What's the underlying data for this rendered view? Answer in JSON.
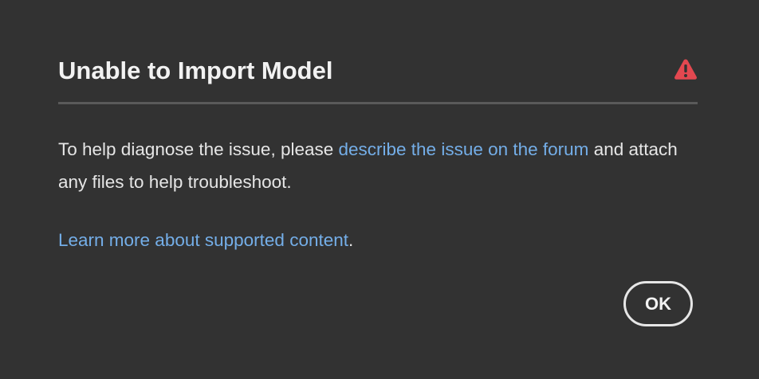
{
  "dialog": {
    "title": "Unable to Import Model",
    "alert_icon": "alert-triangle-icon",
    "alert_color": "#e34850",
    "message": {
      "prefix": "To help diagnose the issue, please ",
      "link_text": "describe the issue on the forum",
      "suffix": " and attach any files to help troubleshoot."
    },
    "learn_more": {
      "link_text": "Learn more about supported content",
      "suffix": "."
    },
    "ok_label": "OK"
  },
  "colors": {
    "background": "#323232",
    "link": "#74aee8",
    "divider": "#5a5a5a",
    "text": "#e6e6e6"
  }
}
